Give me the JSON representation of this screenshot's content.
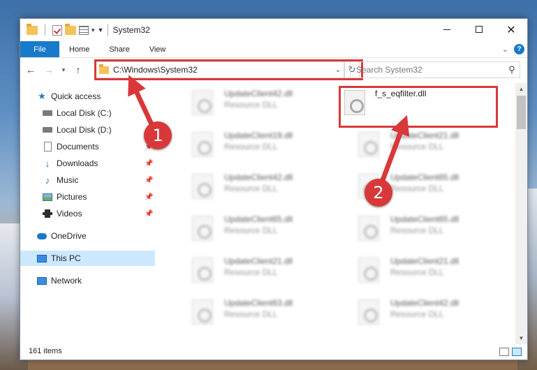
{
  "window": {
    "title": "System32"
  },
  "ribbon": {
    "tabs": [
      "File",
      "Home",
      "Share",
      "View"
    ]
  },
  "nav": {
    "address": "C:\\Windows\\System32",
    "search_placeholder": "Search System32"
  },
  "sidebar": {
    "items": [
      {
        "label": "Quick access",
        "icon": "star-icon"
      },
      {
        "label": "Local Disk (C:)",
        "icon": "disk-icon"
      },
      {
        "label": "Local Disk (D:)",
        "icon": "disk-icon"
      },
      {
        "label": "Documents",
        "icon": "documents-icon",
        "pinned": true
      },
      {
        "label": "Downloads",
        "icon": "download-icon",
        "pinned": true
      },
      {
        "label": "Music",
        "icon": "music-icon",
        "pinned": true
      },
      {
        "label": "Pictures",
        "icon": "pictures-icon",
        "pinned": true
      },
      {
        "label": "Videos",
        "icon": "videos-icon",
        "pinned": true
      },
      {
        "label": "OneDrive",
        "icon": "cloud-icon"
      },
      {
        "label": "This PC",
        "icon": "computer-icon",
        "selected": true
      },
      {
        "label": "Network",
        "icon": "network-icon"
      }
    ]
  },
  "files": {
    "target": {
      "name": "f_s_eqfilter.dll"
    },
    "left_column": [
      {
        "name": "UpdateClient42.dll",
        "type": "Resource DLL"
      },
      {
        "name": "UpdateClient19.dll",
        "type": "Resource DLL"
      },
      {
        "name": "UpdateClient42.dll",
        "type": "Resource DLL"
      },
      {
        "name": "UpdateClient65.dll",
        "type": "Resource DLL"
      },
      {
        "name": "UpdateClient21.dll",
        "type": "Resource DLL"
      },
      {
        "name": "UpdateClient63.dll",
        "type": "Resource DLL"
      }
    ],
    "right_column": [
      {
        "name": "UpdateClient21.dll",
        "type": "Resource DLL"
      },
      {
        "name": "UpdateClient65.dll",
        "type": "Resource DLL"
      },
      {
        "name": "UpdateClient65.dll",
        "type": "Resource DLL"
      },
      {
        "name": "UpdateClient21.dll",
        "type": "Resource DLL"
      },
      {
        "name": "UpdateClient42.dll",
        "type": "Resource DLL"
      }
    ]
  },
  "status": {
    "item_count": "161 items"
  },
  "annotations": {
    "step1": "1",
    "step2": "2",
    "highlight_color": "#d9383a"
  },
  "colors": {
    "accent": "#1979ca",
    "selection": "#cce8ff"
  }
}
